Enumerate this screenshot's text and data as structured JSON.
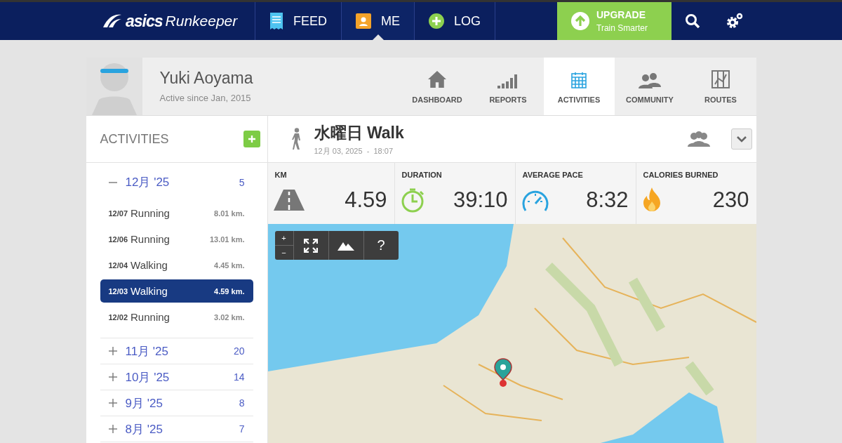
{
  "logo": {
    "brand": "asics",
    "product": "Runkeeper"
  },
  "nav": [
    {
      "label": "FEED",
      "kind": "feed",
      "selected": false
    },
    {
      "label": "ME",
      "kind": "me",
      "selected": true
    },
    {
      "label": "LOG",
      "kind": "log",
      "selected": false
    }
  ],
  "upgrade": {
    "title": "UPGRADE",
    "subtitle": "Train Smarter"
  },
  "profile": {
    "name": "Yuki Aoyama",
    "since": "Active since Jan, 2015"
  },
  "tabs": [
    {
      "label": "DASHBOARD",
      "kind": "home",
      "selected": false
    },
    {
      "label": "REPORTS",
      "kind": "bars",
      "selected": false
    },
    {
      "label": "ACTIVITIES",
      "kind": "calendar",
      "selected": true
    },
    {
      "label": "COMMUNITY",
      "kind": "people",
      "selected": false
    },
    {
      "label": "ROUTES",
      "kind": "route",
      "selected": false
    }
  ],
  "sidebar": {
    "title": "ACTIVITIES",
    "months": [
      {
        "label": "12月 '25",
        "count": "5",
        "expanded": true,
        "children": [
          {
            "date": "12/07",
            "type": "Running",
            "distance": "8.01 km.",
            "selected": false
          },
          {
            "date": "12/06",
            "type": "Running",
            "distance": "13.01 km.",
            "selected": false
          },
          {
            "date": "12/04",
            "type": "Walking",
            "distance": "4.45 km.",
            "selected": false
          },
          {
            "date": "12/03",
            "type": "Walking",
            "distance": "4.59 km.",
            "selected": true
          },
          {
            "date": "12/02",
            "type": "Running",
            "distance": "3.02 km.",
            "selected": false
          }
        ]
      },
      {
        "label": "11月 '25",
        "count": "20",
        "expanded": false
      },
      {
        "label": "10月 '25",
        "count": "14",
        "expanded": false
      },
      {
        "label": "9月 '25",
        "count": "8",
        "expanded": false
      },
      {
        "label": "8月 '25",
        "count": "7",
        "expanded": false
      }
    ]
  },
  "activity": {
    "title": "水曜日 Walk",
    "date": "12月 03, 2025",
    "separator": "-",
    "time": "18:07"
  },
  "stats": [
    {
      "label": "KM",
      "value": "4.59",
      "kind": "road"
    },
    {
      "label": "DURATION",
      "value": "39:10",
      "kind": "stopwatch"
    },
    {
      "label": "AVERAGE PACE",
      "value": "8:32",
      "kind": "gauge"
    },
    {
      "label": "CALORIES BURNED",
      "value": "230",
      "kind": "flame"
    }
  ],
  "map_controls": {
    "zoom_in": "+",
    "zoom_out": "−",
    "help": "?"
  }
}
